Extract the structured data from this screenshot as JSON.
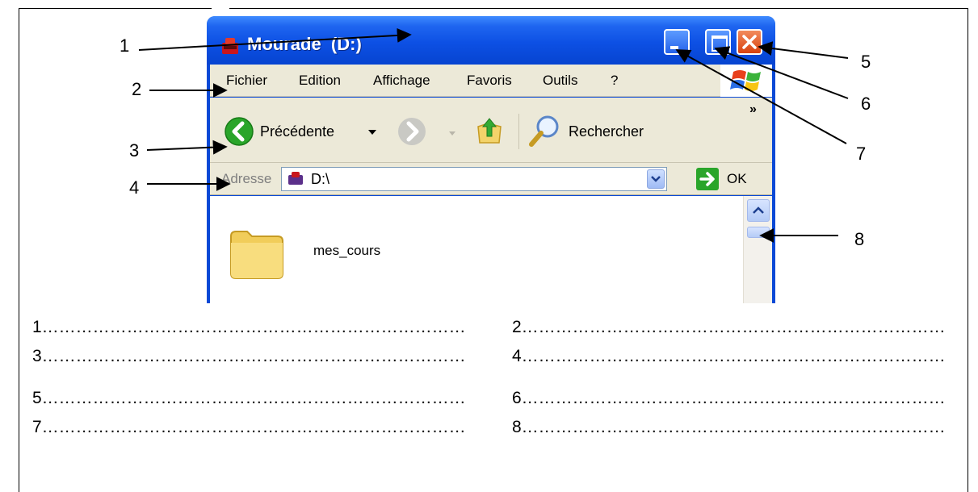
{
  "window": {
    "title": "Mourade  (D:)",
    "menu": [
      "Fichier",
      "Edition",
      "Affichage",
      "Favoris",
      "Outils",
      "?"
    ],
    "toolbar": {
      "back_label": "Précédente",
      "search_label": "Rechercher",
      "more": "»"
    },
    "address": {
      "label": "Adresse",
      "value": "D:\\",
      "go_label": "OK"
    },
    "content": {
      "folder_name": "mes_cours"
    }
  },
  "callouts": [
    "1",
    "2",
    "3",
    "4",
    "5",
    "6",
    "7",
    "8"
  ],
  "worksheet": {
    "rows": [
      [
        "1…………………………………………………………………",
        "2…………………………………………………………………"
      ],
      [
        "3…………………………………………………………………",
        "4…………………………………………………………………"
      ],
      [
        "5…………………………………………………………………",
        "6…………………………………………………………………"
      ],
      [
        "7…………………………………………………………………",
        "8…………………………………………………………………"
      ]
    ]
  },
  "colors": {
    "titlebar": "#0d50e4",
    "chrome": "#ece9d8",
    "close": "#d8410e"
  }
}
